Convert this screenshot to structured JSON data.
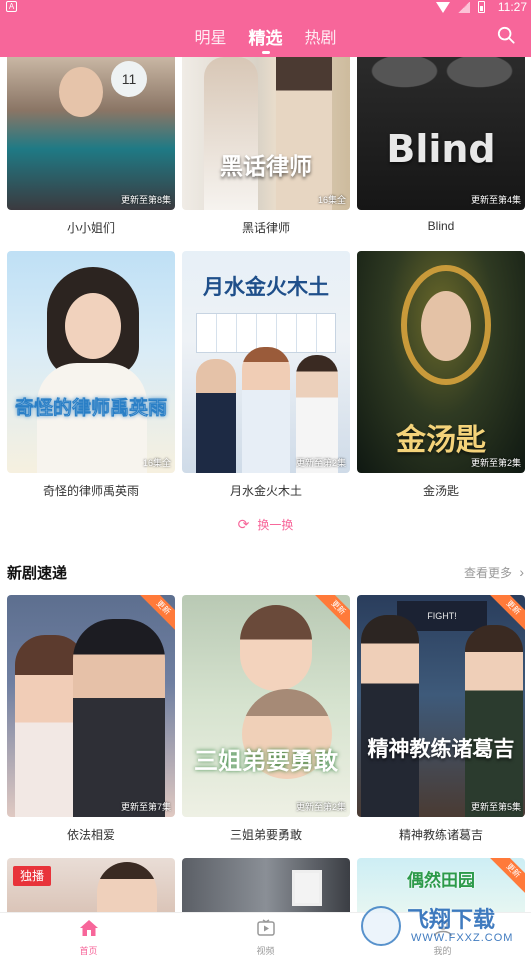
{
  "status_bar": {
    "app_badge": "A",
    "time": "11:27"
  },
  "header": {
    "tabs": [
      {
        "label": "明星",
        "active": false
      },
      {
        "label": "精选",
        "active": true
      },
      {
        "label": "热剧",
        "active": false
      }
    ],
    "search_icon": "search-icon",
    "color": "#f7669a"
  },
  "featured": [
    {
      "name": "小小姐们",
      "episode": "更新至第8集",
      "poster_text": ""
    },
    {
      "name": "黑话律师",
      "episode": "16集全",
      "poster_text": "黑话律师"
    },
    {
      "name": "Blind",
      "episode": "更新至第4集",
      "poster_text": "Blind"
    },
    {
      "name": "奇怪的律师禹英雨",
      "episode": "16集全",
      "poster_text": "奇怪的律师禹英雨"
    },
    {
      "name": "月水金火木土",
      "episode": "更新至第2集",
      "poster_text": "月水金火木土"
    },
    {
      "name": "金汤匙",
      "episode": "更新至第2集",
      "poster_text": "金汤匙"
    }
  ],
  "refresh_label": "换一换",
  "new_dramas": {
    "title": "新剧速递",
    "more_label": "查看更多",
    "items": [
      {
        "name": "依法相爱",
        "episode": "更新至第7集",
        "badge": "更新"
      },
      {
        "name": "三姐弟要勇敢",
        "episode": "更新至第2集",
        "badge": "更新",
        "poster_text": "三姐弟要勇敢"
      },
      {
        "name": "精神教练诸葛吉",
        "episode": "更新至第5集",
        "badge": "更新",
        "poster_text": "精神教练诸葛吉"
      }
    ],
    "row2": [
      {
        "badge": "独播"
      },
      {
        "badge": ""
      },
      {
        "badge": "更新",
        "poster_text": "偶然田园"
      }
    ]
  },
  "bottom_nav": [
    {
      "label": "首页",
      "icon": "home-icon",
      "active": true
    },
    {
      "label": "视频",
      "icon": "video-icon",
      "active": false
    },
    {
      "label": "我的",
      "icon": "profile-icon",
      "active": false
    }
  ],
  "watermark": {
    "text": "飞翔下载",
    "url": "WWW.FXXZ.COM"
  }
}
